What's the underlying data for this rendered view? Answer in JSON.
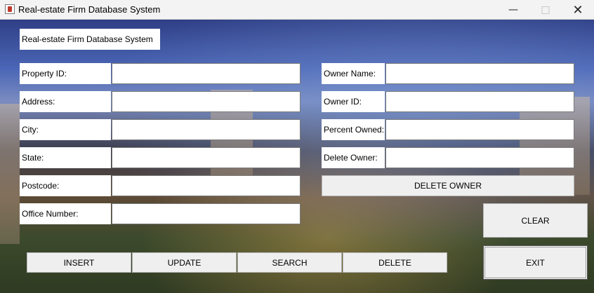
{
  "window": {
    "title": "Real-estate Firm Database System"
  },
  "header": {
    "label": "Real-estate Firm Database System"
  },
  "property": {
    "property_id_label": "Property ID:",
    "property_id_value": "",
    "address_label": "Address:",
    "address_value": "",
    "city_label": "City:",
    "city_value": "",
    "state_label": "State:",
    "state_value": "",
    "postcode_label": "Postcode:",
    "postcode_value": "",
    "office_number_label": "Office Number:",
    "office_number_value": ""
  },
  "owner": {
    "owner_name_label": "Owner Name:",
    "owner_name_value": "",
    "owner_id_label": "Owner ID:",
    "owner_id_value": "",
    "percent_owned_label": "Percent Owned:",
    "percent_owned_value": "",
    "delete_owner_label": "Delete Owner:",
    "delete_owner_value": ""
  },
  "buttons": {
    "delete_owner": "DELETE OWNER",
    "clear": "CLEAR",
    "exit": "EXIT",
    "insert": "INSERT",
    "update": "UPDATE",
    "search": "SEARCH",
    "delete": "DELETE"
  },
  "icons": {
    "app": "java-app-icon",
    "minimize": "minimize-icon",
    "maximize": "maximize-icon",
    "close": "close-icon"
  }
}
